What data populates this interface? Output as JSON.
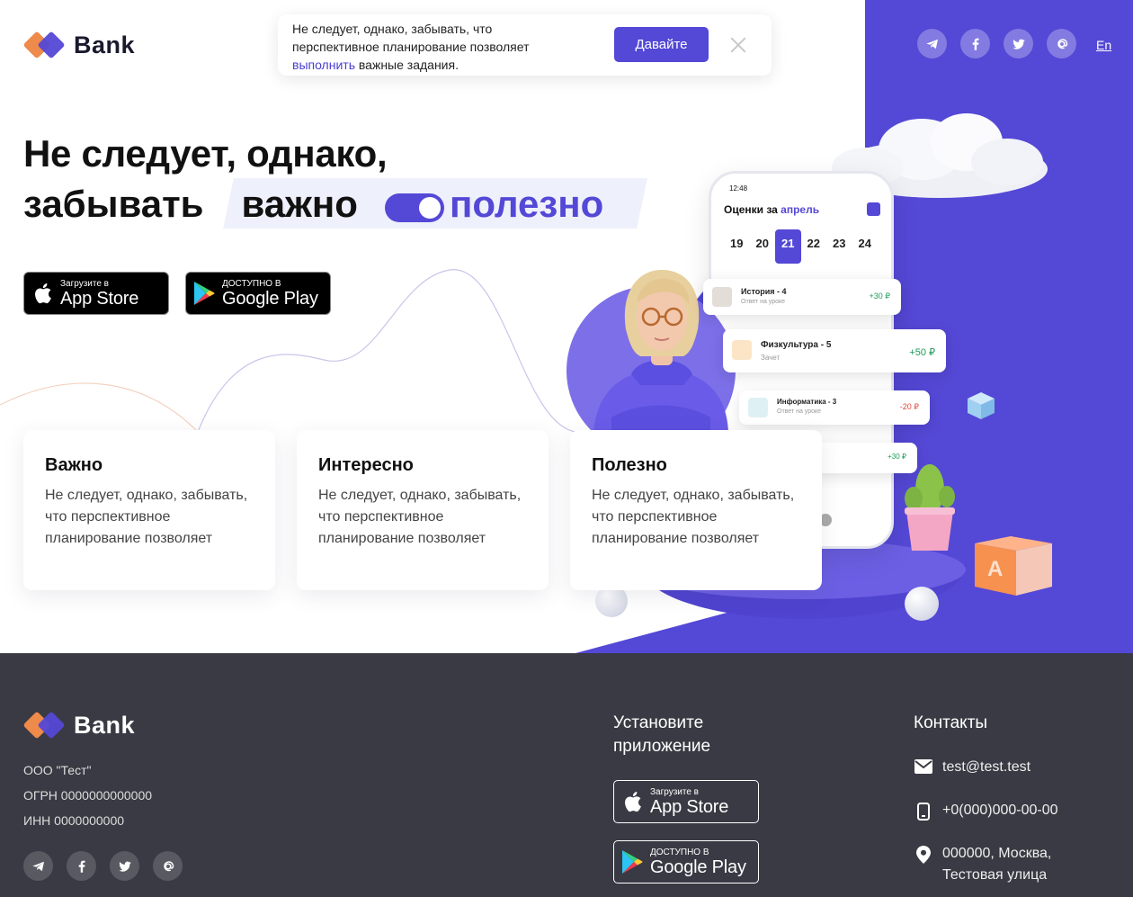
{
  "brand": {
    "name": "Bank"
  },
  "notice": {
    "text_before": "Не следует, однако, забывать, что перспективное планирование позволяет ",
    "link": "выполнить",
    "text_after": " важные задания.",
    "button": "Давайте"
  },
  "header": {
    "lang": "En"
  },
  "hero": {
    "line1": "Не следует, однако,",
    "word1": "забывать",
    "word2": "важно",
    "word3": "полезно"
  },
  "stores": {
    "appstore_small": "Загрузите в",
    "appstore_big": "App Store",
    "google_small": "ДОСТУПНО В",
    "google_big": "Google Play"
  },
  "cards": [
    {
      "title": "Важно",
      "text": "Не следует, однако, забывать, что перспективное планирование позволяет"
    },
    {
      "title": "Интересно",
      "text": "Не следует, однако, забывать, что перспективное планирование позволяет"
    },
    {
      "title": "Полезно",
      "text": "Не следует, однако, забывать, что перспективное планирование позволяет"
    }
  ],
  "phone": {
    "time": "12:48",
    "title": "Оценки за ",
    "month": "апрель",
    "days": [
      "19",
      "20",
      "21",
      "22",
      "23",
      "24"
    ],
    "grades": [
      {
        "title": "История - 4",
        "sub": "Ответ на уроке",
        "amount": "+30 ₽"
      },
      {
        "title": "Физкультура - 5",
        "sub": "Зачет",
        "amount": "+50 ₽"
      },
      {
        "title": "Информатика - 3",
        "sub": "Ответ на уроке",
        "amount": "-20 ₽"
      },
      {
        "amount": "+30 ₽"
      }
    ]
  },
  "footer": {
    "company": "ООО \"Тест\"",
    "ogrn": "ОГРН 0000000000000",
    "inn": "ИНН 0000000000",
    "install_title": "Установите приложение",
    "contacts_title": "Контакты",
    "email": "test@test.test",
    "phone": "+0(000)000-00-00",
    "address": "000000, Москва, Тестовая улица"
  },
  "colors": {
    "accent": "#5448d6",
    "orange": "#ee8a4a",
    "footer_bg": "#3a3a44"
  },
  "icons": [
    "telegram-icon",
    "facebook-icon",
    "twitter-icon",
    "at-icon",
    "apple-icon",
    "google-play-icon",
    "close-icon",
    "mail-icon",
    "phone-icon",
    "location-icon"
  ]
}
